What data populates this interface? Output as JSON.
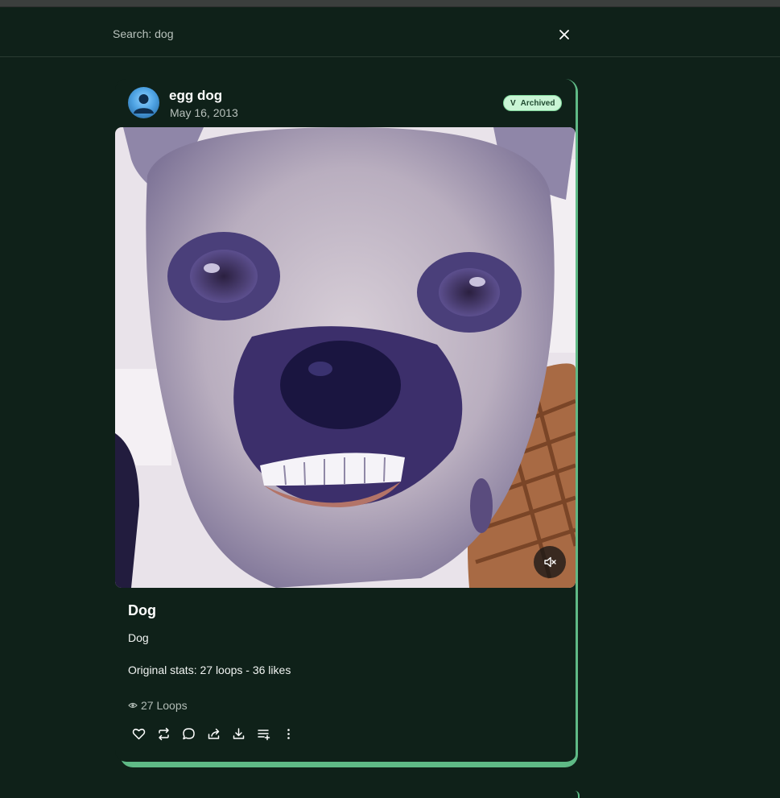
{
  "search": {
    "title": "Search: dog"
  },
  "post": {
    "author": "egg dog",
    "date": "May 16, 2013",
    "badge": "Archived",
    "badge_mark": "V",
    "title": "Dog",
    "description": "Dog",
    "original_stats": "Original stats: 27 loops - 36 likes",
    "loops": "27 Loops"
  },
  "icons": {
    "close": "close-icon",
    "mute": "volume-mute-icon",
    "eye": "eye-icon",
    "actions": [
      "heart-icon",
      "repost-icon",
      "comment-icon",
      "share-icon",
      "download-icon",
      "add-to-playlist-icon",
      "more-icon"
    ]
  },
  "colors": {
    "background": "#0f2119",
    "accent": "#5fba86",
    "badge_bg": "#c9f5d5"
  }
}
